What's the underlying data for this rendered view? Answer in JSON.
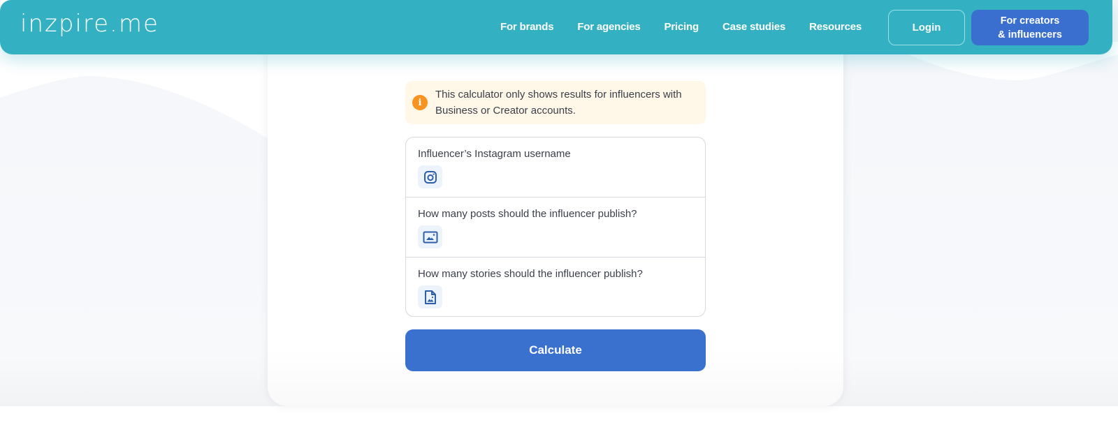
{
  "header": {
    "logo": "inzpire.me",
    "nav": [
      {
        "label": "For brands"
      },
      {
        "label": "For agencies"
      },
      {
        "label": "Pricing"
      },
      {
        "label": "Case studies"
      },
      {
        "label": "Resources"
      }
    ],
    "login_label": "Login",
    "creators_label_line1": "For creators",
    "creators_label_line2": "& influencers"
  },
  "calculator": {
    "notice": {
      "icon": "info-icon",
      "text": "This calculator only shows results for influencers with Business or Creator accounts."
    },
    "fields": [
      {
        "label": "Influencer’s Instagram username",
        "icon": "instagram-icon"
      },
      {
        "label": "How many posts should the influencer publish?",
        "icon": "image-icon"
      },
      {
        "label": "How many stories should the influencer publish?",
        "icon": "file-image-icon"
      }
    ],
    "submit_label": "Calculate"
  },
  "colors": {
    "header": "#33b1c2",
    "primary": "#3a71cf",
    "notice_bg": "#fff7e8",
    "notice_icon": "#f7931e"
  }
}
